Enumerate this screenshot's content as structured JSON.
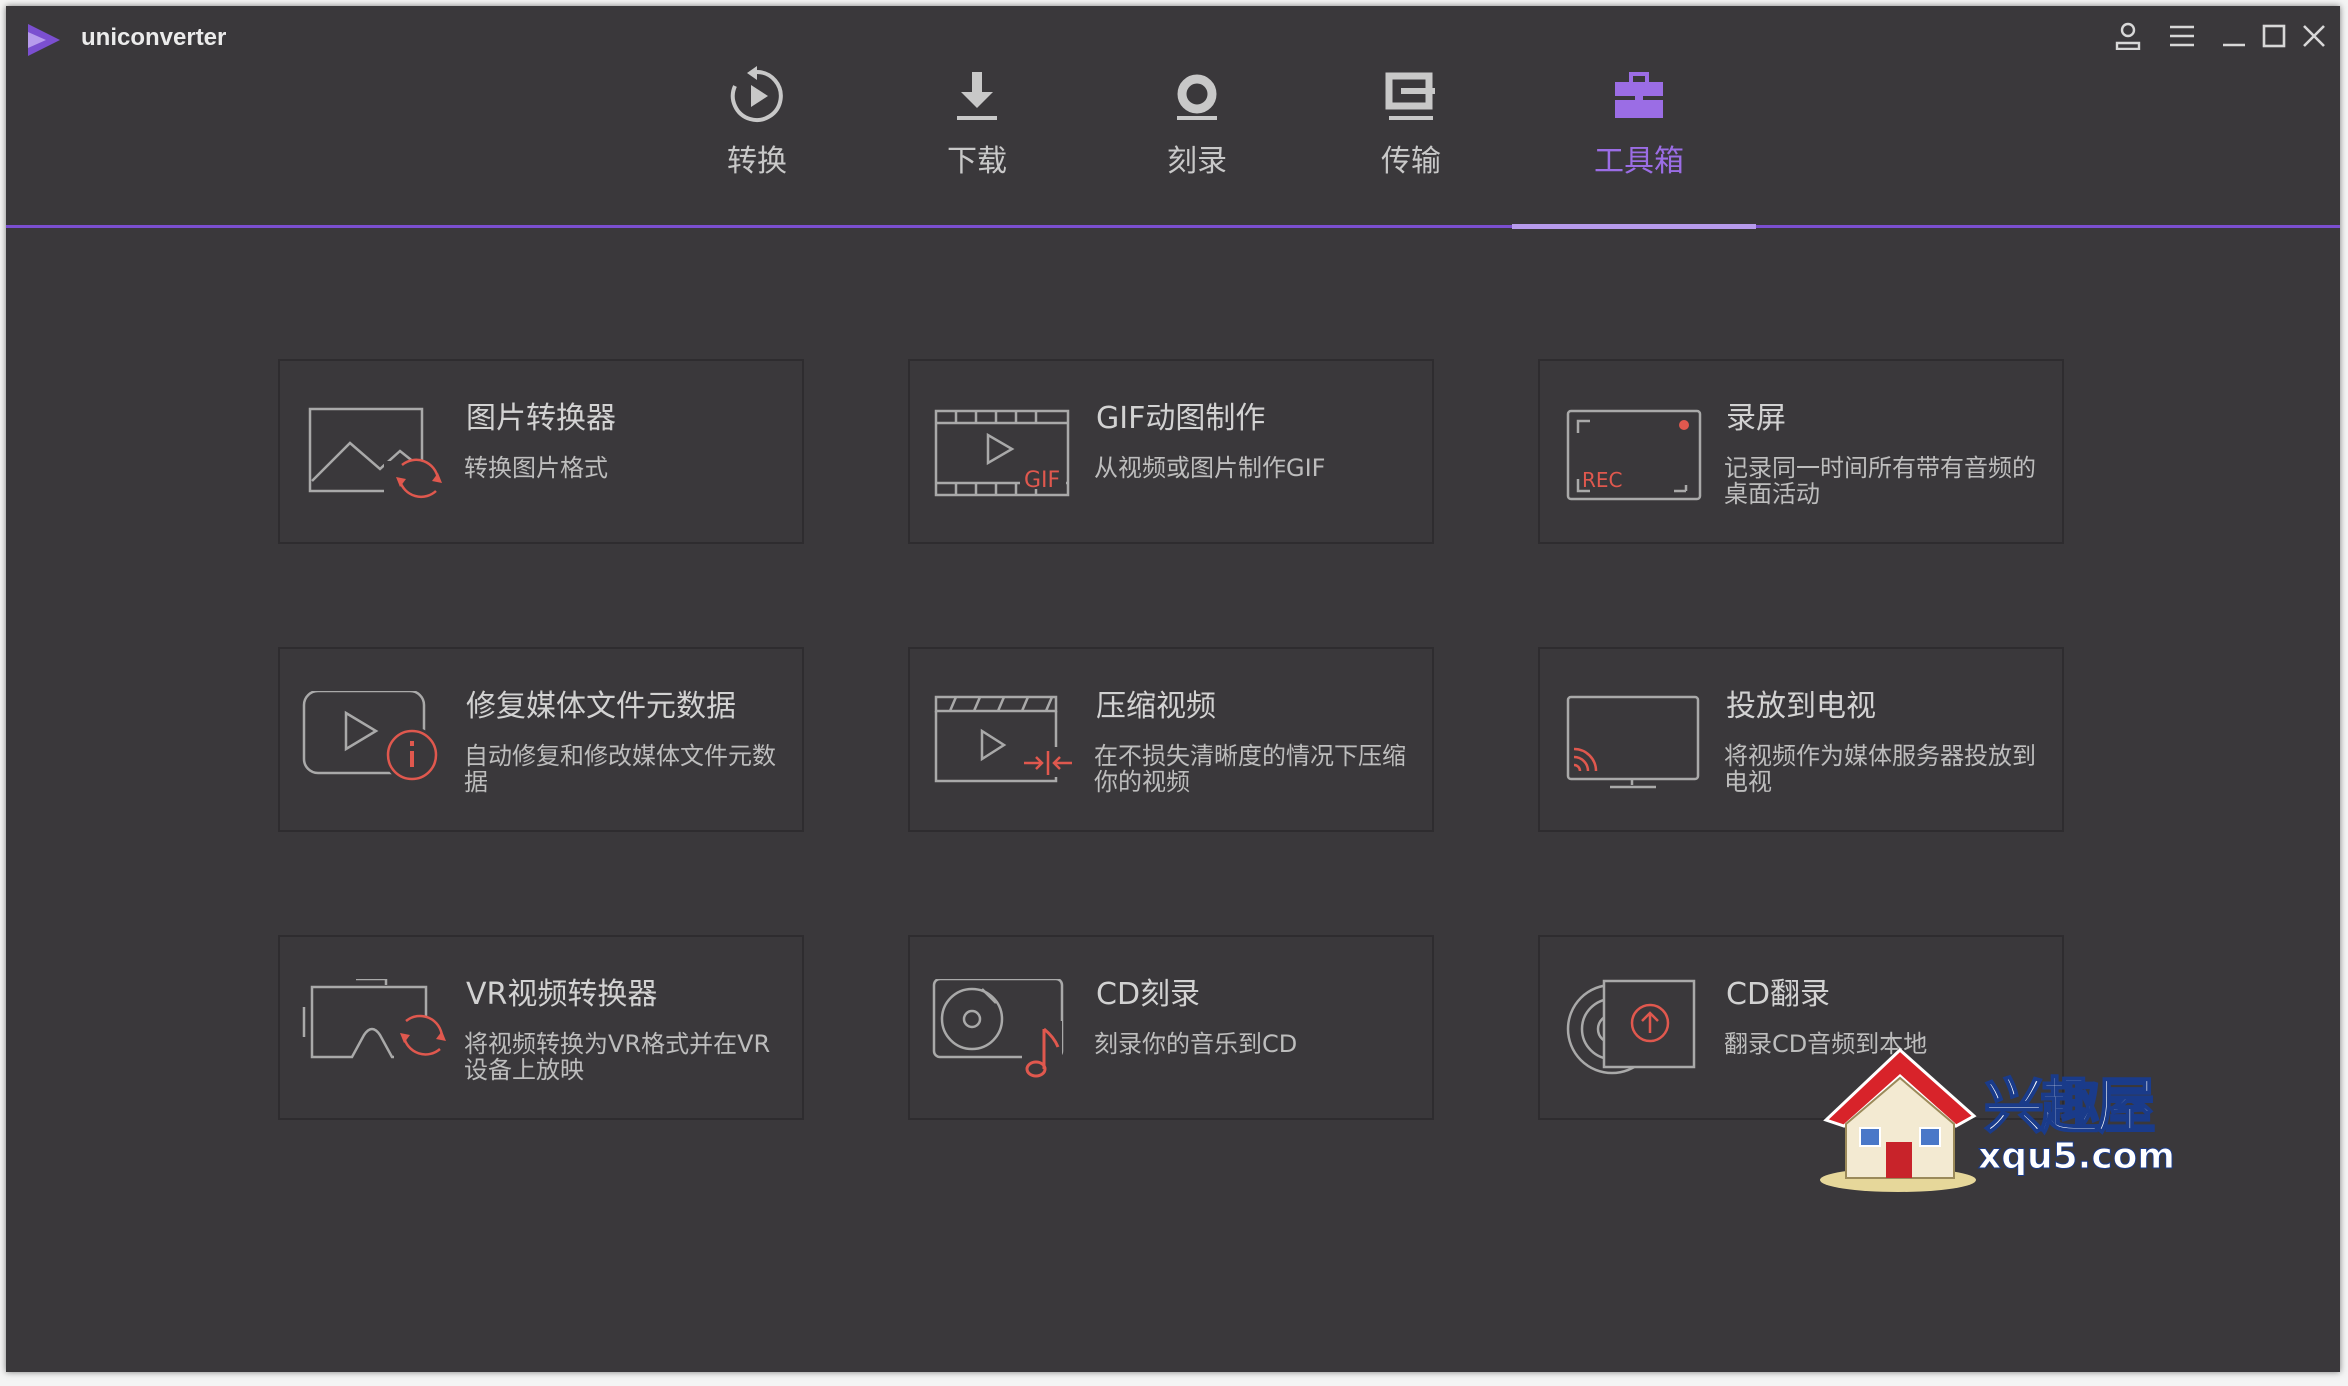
{
  "window": {
    "title": "uniconverter",
    "accent_color": "#9b6de5",
    "icon_color": "#e0584e"
  },
  "nav": {
    "items": [
      {
        "label": "转换",
        "icon": "convert-icon"
      },
      {
        "label": "下载",
        "icon": "download-icon"
      },
      {
        "label": "刻录",
        "icon": "burn-icon"
      },
      {
        "label": "传输",
        "icon": "transfer-icon"
      },
      {
        "label": "工具箱",
        "icon": "toolbox-icon",
        "active": true
      }
    ]
  },
  "tools": [
    {
      "title": "图片转换器",
      "desc": "转换图片格式",
      "icon": "image-convert-icon"
    },
    {
      "title": "GIF动图制作",
      "desc": "从视频或图片制作GIF",
      "icon": "gif-maker-icon",
      "icon_text": "GIF"
    },
    {
      "title": "录屏",
      "desc": "记录同一时间所有带有音频的桌面活动",
      "icon": "screen-record-icon",
      "icon_text": "REC"
    },
    {
      "title": "修复媒体文件元数据",
      "desc": "自动修复和修改媒体文件元数据",
      "icon": "fix-metadata-icon"
    },
    {
      "title": "压缩视频",
      "desc": "在不损失清晰度的情况下压缩你的视频",
      "icon": "compress-video-icon"
    },
    {
      "title": "投放到电视",
      "desc": "将视频作为媒体服务器投放到电视",
      "icon": "cast-tv-icon"
    },
    {
      "title": "VR视频转换器",
      "desc": "将视频转换为VR格式并在VR设备上放映",
      "icon": "vr-convert-icon"
    },
    {
      "title": "CD刻录",
      "desc": "刻录你的音乐到CD",
      "icon": "cd-burn-icon"
    },
    {
      "title": "CD翻录",
      "desc": "翻录CD音频到本地",
      "icon": "cd-rip-icon"
    }
  ],
  "watermark": {
    "name": "兴趣屋",
    "url": "xqu5.com"
  }
}
